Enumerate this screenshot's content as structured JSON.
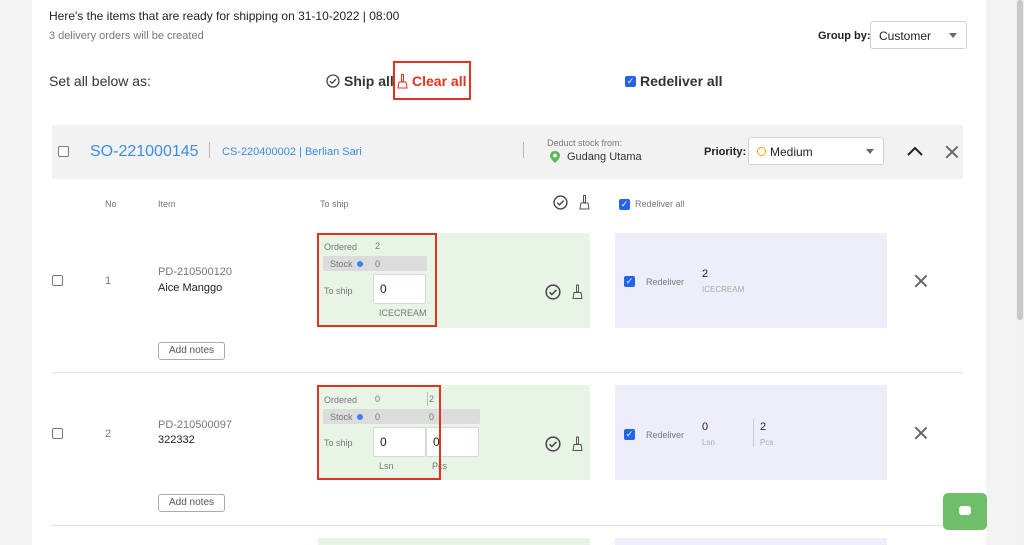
{
  "summary": {
    "title": "Here's the items that are ready for shipping on 31-10-2022 | 08:00",
    "subtitle": "3 delivery orders will be created"
  },
  "group_by": {
    "label": "Group by:",
    "value": "Customer"
  },
  "bulk": {
    "label": "Set all below as:",
    "ship_all": "Ship all",
    "clear_all": "Clear all",
    "redeliver_all": "Redeliver all"
  },
  "order": {
    "so_number": "SO-221000145",
    "customer": "CS-220400002 | Berlian Sari",
    "deduct_label": "Deduct stock from:",
    "warehouse": "Gudang Utama",
    "priority_label": "Priority:",
    "priority_value": "Medium"
  },
  "columns": {
    "no": "No",
    "item": "Item",
    "to_ship": "To ship",
    "redeliver_all": "Redeliver all"
  },
  "items": [
    {
      "no": "1",
      "code": "PD-210500120",
      "name": "Aice Manggo",
      "ordered_label": "Ordered",
      "ordered": "2",
      "stock_label": "Stock",
      "stock": "0",
      "to_ship_label": "To ship",
      "to_ship": "0",
      "unit": "ICECREAM",
      "redeliver_label": "Redeliver",
      "redeliver_qty": "2",
      "redeliver_unit": "ICECREAM",
      "notes_button": "Add notes"
    },
    {
      "no": "2",
      "code": "PD-210500097",
      "name": "322332",
      "ordered_label": "Ordered",
      "ordered_1": "0",
      "ordered_2": "2",
      "stock_label": "Stock",
      "stock_1": "0",
      "stock_2": "0",
      "to_ship_label": "To ship",
      "to_ship_1": "0",
      "to_ship_2": "0",
      "unit_1": "Lsn",
      "unit_2": "Pcs",
      "redeliver_label": "Redeliver",
      "redeliver_qty_1": "0",
      "redeliver_unit_1": "Lsn",
      "redeliver_qty_2": "2",
      "redeliver_unit_2": "Pcs",
      "notes_button": "Add notes"
    }
  ],
  "colors": {
    "accent_blue": "#3b8ee0",
    "clear_red": "#e2331f",
    "ship_bg": "#e8f4e6",
    "redeliver_bg": "#eeeefa",
    "priority_dot": "#f0a020",
    "warehouse_pin": "#5cb85c"
  }
}
